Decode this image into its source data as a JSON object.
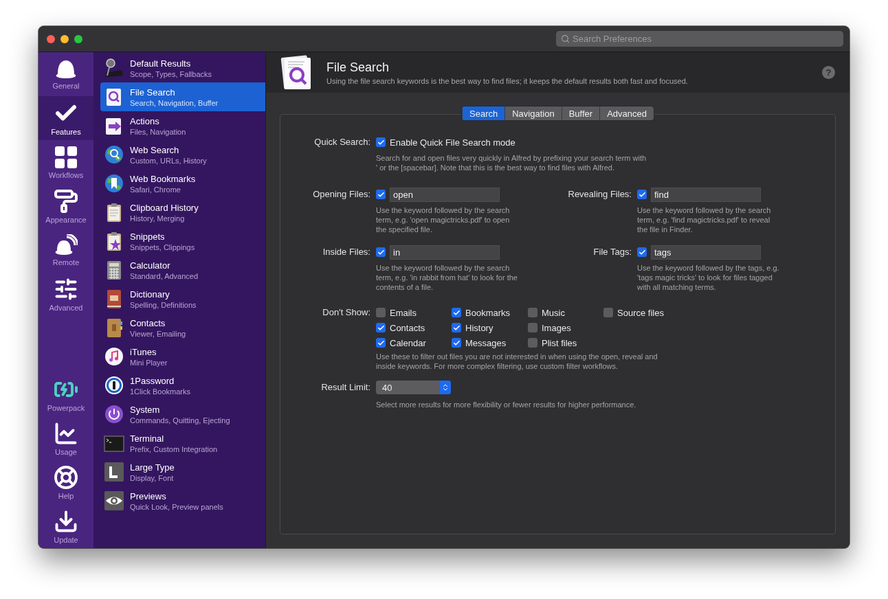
{
  "window": {
    "search": {
      "placeholder": "Search Preferences"
    }
  },
  "rail": {
    "top": [
      {
        "label": "General",
        "selected": false
      },
      {
        "label": "Features",
        "selected": true
      },
      {
        "label": "Workflows",
        "selected": false
      },
      {
        "label": "Appearance",
        "selected": false
      },
      {
        "label": "Remote",
        "selected": false
      },
      {
        "label": "Advanced",
        "selected": false
      }
    ],
    "bottom": [
      {
        "label": "Powerpack",
        "selected": false
      },
      {
        "label": "Usage",
        "selected": false
      },
      {
        "label": "Help",
        "selected": false
      },
      {
        "label": "Update",
        "selected": false
      }
    ]
  },
  "features": [
    {
      "title": "Default Results",
      "subtitle": "Scope, Types, Fallbacks",
      "selected": false
    },
    {
      "title": "File Search",
      "subtitle": "Search, Navigation, Buffer",
      "selected": true
    },
    {
      "title": "Actions",
      "subtitle": "Files, Navigation",
      "selected": false
    },
    {
      "title": "Web Search",
      "subtitle": "Custom, URLs, History",
      "selected": false
    },
    {
      "title": "Web Bookmarks",
      "subtitle": "Safari, Chrome",
      "selected": false
    },
    {
      "title": "Clipboard History",
      "subtitle": "History, Merging",
      "selected": false
    },
    {
      "title": "Snippets",
      "subtitle": "Snippets, Clippings",
      "selected": false
    },
    {
      "title": "Calculator",
      "subtitle": "Standard, Advanced",
      "selected": false
    },
    {
      "title": "Dictionary",
      "subtitle": "Spelling, Definitions",
      "selected": false
    },
    {
      "title": "Contacts",
      "subtitle": "Viewer, Emailing",
      "selected": false
    },
    {
      "title": "iTunes",
      "subtitle": "Mini Player",
      "selected": false
    },
    {
      "title": "1Password",
      "subtitle": "1Click Bookmarks",
      "selected": false
    },
    {
      "title": "System",
      "subtitle": "Commands, Quitting, Ejecting",
      "selected": false
    },
    {
      "title": "Terminal",
      "subtitle": "Prefix, Custom Integration",
      "selected": false
    },
    {
      "title": "Large Type",
      "subtitle": "Display, Font",
      "selected": false
    },
    {
      "title": "Previews",
      "subtitle": "Quick Look, Preview panels",
      "selected": false
    }
  ],
  "header": {
    "title": "File Search",
    "subtitle": "Using the file search keywords is the best way to find files; it keeps the default results both fast and focused.",
    "help": "?"
  },
  "tabs": [
    {
      "label": "Search",
      "selected": true
    },
    {
      "label": "Navigation",
      "selected": false
    },
    {
      "label": "Buffer",
      "selected": false
    },
    {
      "label": "Advanced",
      "selected": false
    }
  ],
  "quick_search": {
    "label": "Quick Search:",
    "checked": true,
    "option": "Enable Quick File Search mode",
    "note": "Search for and open files very quickly in Alfred by prefixing your search term with\n' or the [spacebar]. Note that this is the best way to find files with Alfred."
  },
  "keywords": [
    {
      "label": "Opening Files:",
      "checked": true,
      "value": "open",
      "note": "Use the keyword followed by the search\nterm, e.g. 'open magictricks.pdf' to open\nthe specified file."
    },
    {
      "label": "Revealing Files:",
      "checked": true,
      "value": "find",
      "note": "Use the keyword followed by the search\nterm, e.g. 'find magictricks.pdf' to reveal\nthe file in Finder."
    },
    {
      "label": "Inside Files:",
      "checked": true,
      "value": "in",
      "note": "Use the keyword followed by the search\nterm, e.g. 'in rabbit from hat' to look for the\ncontents of a file."
    },
    {
      "label": "File Tags:",
      "checked": true,
      "value": "tags",
      "note": "Use the keyword followed by the tags, e.g.\n'tags magic tricks' to look for files tagged\nwith all matching terms."
    }
  ],
  "dont_show": {
    "label": "Don't Show:",
    "columns": [
      [
        {
          "label": "Emails",
          "checked": false
        },
        {
          "label": "Contacts",
          "checked": true
        },
        {
          "label": "Calendar",
          "checked": true
        }
      ],
      [
        {
          "label": "Bookmarks",
          "checked": true
        },
        {
          "label": "History",
          "checked": true
        },
        {
          "label": "Messages",
          "checked": true
        }
      ],
      [
        {
          "label": "Music",
          "checked": false
        },
        {
          "label": "Images",
          "checked": false
        },
        {
          "label": "Plist files",
          "checked": false
        }
      ],
      [
        {
          "label": "Source files",
          "checked": false
        }
      ]
    ],
    "note": "Use these to filter out files you are not interested in when using the open, reveal and\ninside keywords. For more complex filtering, use custom filter workflows."
  },
  "result_limit": {
    "label": "Result Limit:",
    "value": "40",
    "note": "Select more results for more flexibility or fewer results for higher performance."
  }
}
